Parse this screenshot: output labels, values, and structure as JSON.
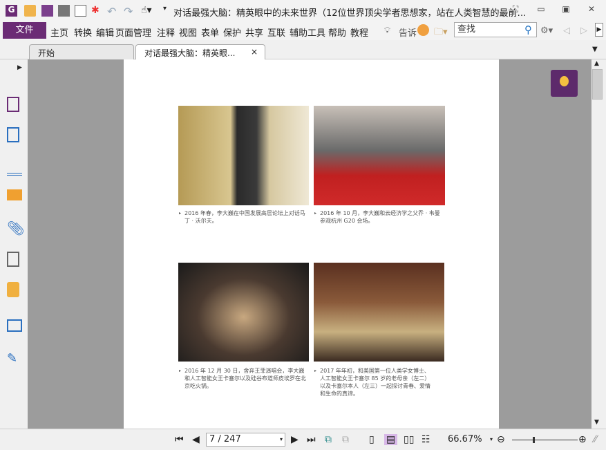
{
  "window": {
    "title": "对话最强大脑：精英眼中的未来世界（12位世界顶尖学者思想家，站在人类智慧的最前…"
  },
  "menu": {
    "file": "文件",
    "items": [
      "主页",
      "转换",
      "编辑",
      "页面管理",
      "注释",
      "视图",
      "表单",
      "保护",
      "共享",
      "互联",
      "辅助工具",
      "帮助",
      "教程"
    ],
    "tell": "告诉",
    "search_placeholder": "查找"
  },
  "tabs": [
    {
      "label": "开始"
    },
    {
      "label": "对话最强大脑：精英眼..."
    }
  ],
  "tab_close": "×",
  "captions": [
    "2016 年春，李大巍在中国发展高层论坛上对话马丁 · 沃尔夫。",
    "2016 年 10 月，李大巍和云经济学之父乔 · 韦曼参观杭州 G20 会场。",
    "2016 年 12 月 30 日，舍弃王菲演唱会，李大巍和人工智能女王卡塞尔以及硅谷布道师皮埃罗在北京吃火锅。",
    "2017 年年初，和美国第一位人类学女博士、人工智能女王卡塞尔 85 岁的老母亲（左二）以及卡塞尔本人（左三）一起探讨青春、爱情和生命的真谛。"
  ],
  "status": {
    "page": "7 / 247",
    "zoom": "66.67%"
  },
  "colors": {
    "accent": "#6b2c75"
  }
}
